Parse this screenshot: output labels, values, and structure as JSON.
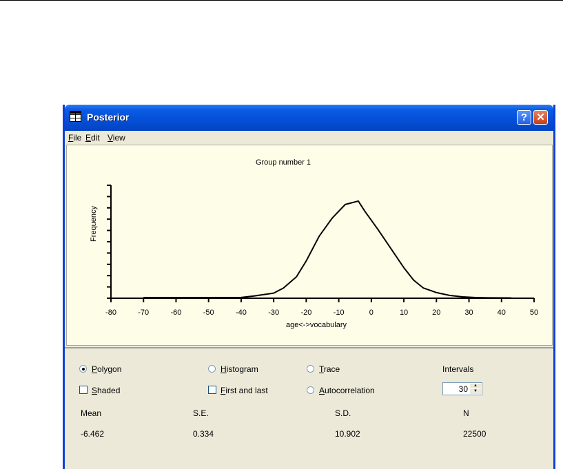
{
  "window": {
    "title": "Posterior",
    "help_label": "?",
    "close_label": "✕",
    "accent": "#0450d8",
    "close_color": "#c7401a"
  },
  "menu": {
    "file": {
      "key": "F",
      "rest": "ile"
    },
    "edit": {
      "key": "E",
      "rest": "dit"
    },
    "view": {
      "key": "V",
      "rest": "iew"
    }
  },
  "chart_data": {
    "type": "line",
    "title": "Group number 1",
    "xlabel": "age<->vocabulary",
    "ylabel": "Frequency",
    "xlim": [
      -80,
      50
    ],
    "x_ticks": [
      -80,
      -70,
      -60,
      -50,
      -40,
      -30,
      -20,
      -10,
      0,
      10,
      20,
      30,
      40,
      50
    ],
    "ylim": [
      0,
      1
    ],
    "y_ticks": [
      0,
      0.1,
      0.2,
      0.3,
      0.4,
      0.5,
      0.6,
      0.7,
      0.8,
      0.9,
      1.0
    ],
    "grid": false,
    "legend": "none",
    "series": [
      {
        "x": [
          -70,
          -60,
          -50,
          -40,
          -36,
          -30,
          -27,
          -23,
          -20,
          -16,
          -12,
          -8,
          -4,
          -2,
          2,
          6,
          10,
          13,
          16,
          20,
          24,
          28,
          32,
          36,
          40,
          43
        ],
        "y": [
          0.005,
          0.005,
          0.005,
          0.007,
          0.02,
          0.045,
          0.09,
          0.19,
          0.33,
          0.55,
          0.71,
          0.83,
          0.86,
          0.77,
          0.61,
          0.44,
          0.27,
          0.16,
          0.09,
          0.05,
          0.025,
          0.012,
          0.006,
          0.004,
          0.003,
          0.002
        ]
      }
    ]
  },
  "controls": {
    "polygon": {
      "key": "P",
      "rest": "olygon",
      "selected": true
    },
    "histogram": {
      "key": "H",
      "rest": "istogram",
      "selected": false
    },
    "trace": {
      "key": "T",
      "rest": "race",
      "selected": false
    },
    "autocorrelation": {
      "key": "A",
      "rest": "utocorrelation",
      "selected": false
    },
    "shaded": {
      "key": "S",
      "rest": "haded",
      "checked": false
    },
    "first_and_last": {
      "key": "F",
      "rest": "irst and last",
      "checked": false
    },
    "intervals_label": "Intervals",
    "intervals_value": "30"
  },
  "stats": {
    "mean_label": "Mean",
    "se_label": "S.E.",
    "sd_label": "S.D.",
    "n_label": "N",
    "mean": "-6.462",
    "se": "0.334",
    "sd": "10.902",
    "n": "22500"
  }
}
